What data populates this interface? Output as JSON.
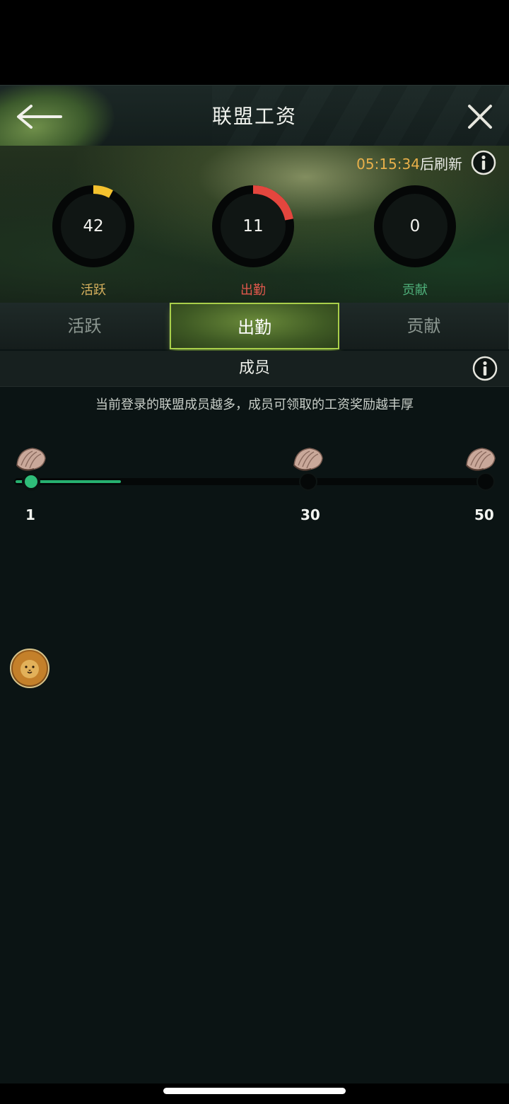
{
  "header": {
    "title": "联盟工资"
  },
  "refresh": {
    "time": "05:15:34",
    "suffix": "后刷新"
  },
  "rings": [
    {
      "value": "42",
      "label": "活跃",
      "color": "#f4c22e",
      "label_color": "#d7b15e",
      "progress": 0.08
    },
    {
      "value": "11",
      "label": "出勤",
      "color": "#e4463e",
      "label_color": "#e0584c",
      "progress": 0.22
    },
    {
      "value": "0",
      "label": "贡献",
      "color": "#3fa56b",
      "label_color": "#4fb07a",
      "progress": 0.0
    }
  ],
  "tabs": [
    {
      "label": "活跃",
      "active": false
    },
    {
      "label": "出勤",
      "active": true
    },
    {
      "label": "贡献",
      "active": false
    }
  ],
  "section": {
    "title": "成员"
  },
  "description": "当前登录的联盟成员越多，成员可领取的工资奖励越丰厚",
  "milestones": [
    {
      "label": "1",
      "reached": true
    },
    {
      "label": "30",
      "reached": false
    },
    {
      "label": "50",
      "reached": false
    }
  ],
  "progress_fraction": 0.22,
  "icons": {
    "back": "back-arrow-icon",
    "close": "close-icon",
    "info": "info-icon",
    "reward": "shell-icon",
    "avatar": "lion-avatar"
  },
  "colors": {
    "accent_green": "#27b070",
    "tab_active_border": "#a9cf4a",
    "timer": "#e8b04a"
  }
}
